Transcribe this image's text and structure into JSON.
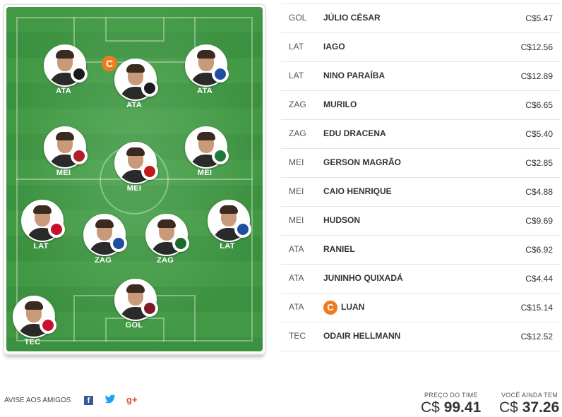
{
  "lineup": {
    "players": [
      {
        "pos": "ATA",
        "crest_color": "#1a1a1a",
        "captain": false
      },
      {
        "pos": "ATA",
        "crest_color": "#1a1a1a",
        "captain": true
      },
      {
        "pos": "ATA",
        "crest_color": "#1e4fa0",
        "captain": false
      },
      {
        "pos": "MEI",
        "crest_color": "#b0202a",
        "captain": false
      },
      {
        "pos": "MEI",
        "crest_color": "#c01b1b",
        "captain": false
      },
      {
        "pos": "MEI",
        "crest_color": "#1f7a3a",
        "captain": false
      },
      {
        "pos": "LAT",
        "crest_color": "#c8102e",
        "captain": false
      },
      {
        "pos": "ZAG",
        "crest_color": "#1e4fa0",
        "captain": false
      },
      {
        "pos": "ZAG",
        "crest_color": "#1a6b2c",
        "captain": false
      },
      {
        "pos": "LAT",
        "crest_color": "#1e4fa0",
        "captain": false
      },
      {
        "pos": "GOL",
        "crest_color": "#7a1a2a",
        "captain": false
      },
      {
        "pos": "TEC",
        "crest_color": "#c8102e",
        "captain": false
      }
    ],
    "captain_badge": "C"
  },
  "table": [
    {
      "pos": "GOL",
      "name": "JÚLIO CÉSAR",
      "price": "C$5.47",
      "captain": false
    },
    {
      "pos": "LAT",
      "name": "IAGO",
      "price": "C$12.56",
      "captain": false
    },
    {
      "pos": "LAT",
      "name": "NINO PARAÍBA",
      "price": "C$12.89",
      "captain": false
    },
    {
      "pos": "ZAG",
      "name": "MURILO",
      "price": "C$6.65",
      "captain": false
    },
    {
      "pos": "ZAG",
      "name": "EDU DRACENA",
      "price": "C$5.40",
      "captain": false
    },
    {
      "pos": "MEI",
      "name": "GERSON MAGRÃO",
      "price": "C$2.85",
      "captain": false
    },
    {
      "pos": "MEI",
      "name": "CAIO HENRIQUE",
      "price": "C$4.88",
      "captain": false
    },
    {
      "pos": "MEI",
      "name": "HUDSON",
      "price": "C$9.69",
      "captain": false
    },
    {
      "pos": "ATA",
      "name": "RANIEL",
      "price": "C$6.92",
      "captain": false
    },
    {
      "pos": "ATA",
      "name": "JUNINHO QUIXADÁ",
      "price": "C$4.44",
      "captain": false
    },
    {
      "pos": "ATA",
      "name": "LUAN",
      "price": "C$15.14",
      "captain": true
    },
    {
      "pos": "TEC",
      "name": "ODAIR HELLMANN",
      "price": "C$12.52",
      "captain": false
    }
  ],
  "footer": {
    "share_label": "AVISE AOS AMIGOS",
    "facebook": "f",
    "twitter": "🐦",
    "googleplus": "g+",
    "price_label": "PREÇO DO TIME",
    "price_currency": "C$",
    "price_value": "99.41",
    "remaining_label": "VOCÊ AINDA TEM",
    "remaining_currency": "C$",
    "remaining_value": "37.26"
  },
  "colors": {
    "captain": "#f07b1e",
    "pitch": "#45a048"
  }
}
